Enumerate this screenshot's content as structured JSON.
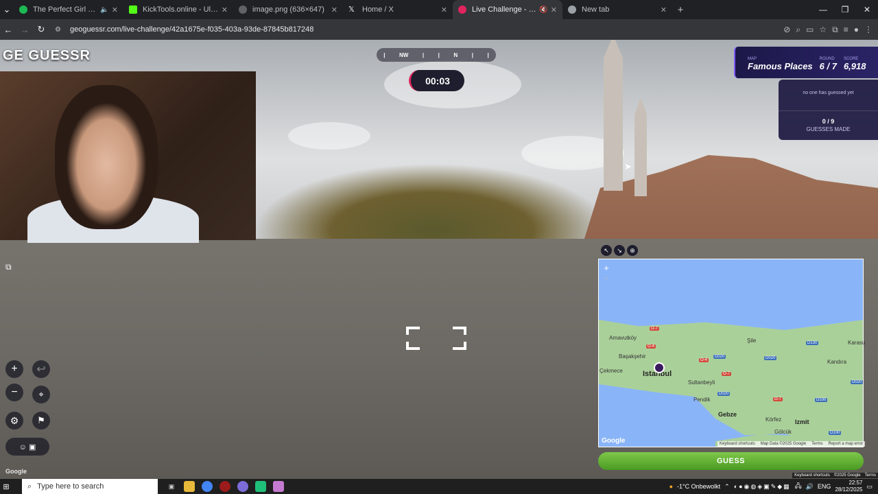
{
  "browser": {
    "tabs": [
      {
        "title": "The Perfect Girl • Mareux",
        "color": "#1db954",
        "audio": true
      },
      {
        "title": "KickTools.online - Ultimate Kick",
        "color": "#53fc18",
        "audio": false
      },
      {
        "title": "image.png (636×647)",
        "color": "#9aa0a6",
        "audio": false
      },
      {
        "title": "Home / X",
        "color": "#ffffff",
        "audio": false
      },
      {
        "title": "Live Challenge - GeoGuessr",
        "color": "#e0245e",
        "audio": true
      },
      {
        "title": "New tab",
        "color": "#9aa0a6",
        "audio": false
      }
    ],
    "url": "geoguessr.com/live-challenge/42a1675e-f035-403a-93de-87845b817248"
  },
  "game": {
    "brand": "GE GUESSR",
    "compass": [
      "NW",
      "N"
    ],
    "timer": "00:03",
    "map_label": "MAP",
    "map_name": "Famous Places",
    "round_label": "ROUND",
    "round": "6 / 7",
    "score_label": "SCORE",
    "score": "6,918",
    "guess_status": "no one has guessed yet",
    "guesses_count": "0 / 9",
    "guesses_label": "GUESSES MADE",
    "guess_button": "GUESS",
    "google": "Google"
  },
  "map": {
    "places": [
      {
        "name": "Istanbul",
        "kind": "city"
      },
      {
        "name": "Arnavutköy",
        "kind": "town"
      },
      {
        "name": "Başakşehir",
        "kind": "town"
      },
      {
        "name": "Sultanbeyli",
        "kind": "town"
      },
      {
        "name": "Pendik",
        "kind": "town"
      },
      {
        "name": "Gebze",
        "kind": "town"
      },
      {
        "name": "Körfez",
        "kind": "town"
      },
      {
        "name": "Izmit",
        "kind": "town"
      },
      {
        "name": "Gölcük",
        "kind": "town"
      },
      {
        "name": "Kandıra",
        "kind": "town"
      },
      {
        "name": "Şile",
        "kind": "town"
      },
      {
        "name": "Karasu",
        "kind": "town"
      },
      {
        "name": "Çekmece",
        "kind": "town"
      }
    ],
    "roads": [
      "O-7",
      "D020",
      "D020",
      "O-4",
      "O-7",
      "O-7",
      "D100",
      "D020",
      "D020",
      "D100",
      "D130",
      "O-4"
    ],
    "google": "Google",
    "footer": [
      "Keyboard shortcuts",
      "Map Data ©2025 Google",
      "Terms",
      "Report a map error"
    ]
  },
  "page_footer": [
    "Keyboard shortcuts",
    "©2025 Google",
    "Terms"
  ],
  "taskbar": {
    "search_placeholder": "Type here to search",
    "weather": "-1°C  Onbewolkt",
    "lang": "ENG",
    "time": "22:57",
    "date": "28/12/2025"
  }
}
